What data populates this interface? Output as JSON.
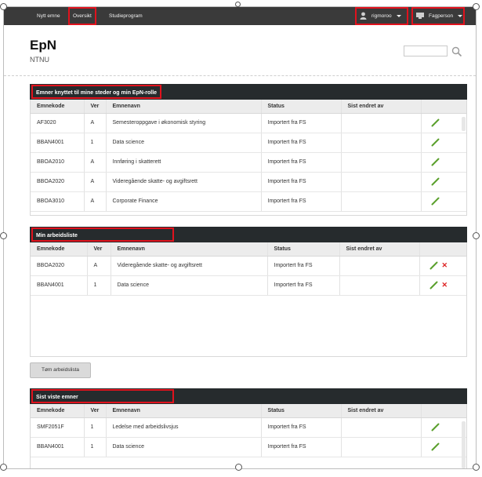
{
  "nav": {
    "links": [
      "Nytt emne",
      "Oversikt",
      "Studieprogram"
    ],
    "user": "rigmoroo",
    "role": "Fagperson"
  },
  "brand": {
    "title": "EpN",
    "subtitle": "NTNU"
  },
  "search": {
    "placeholder": ""
  },
  "sections": [
    {
      "title": "Emner knyttet til mine steder og min EpN-rolle",
      "columns": [
        "Emnekode",
        "Ver",
        "Emnenavn",
        "Status",
        "Sist endret av",
        ""
      ],
      "rows": [
        [
          "AF3020",
          "A",
          "Semesteroppgave i økonomisk styring",
          "Importert fra FS",
          ""
        ],
        [
          "BBAN4001",
          "1",
          "Data science",
          "Importert fra FS",
          ""
        ],
        [
          "BBOA2010",
          "A",
          "Innføring i skatterett",
          "Importert fra FS",
          ""
        ],
        [
          "BBOA2020",
          "A",
          "Videregående skatte- og avgiftsrett",
          "Importert fra FS",
          ""
        ],
        [
          "BBOA3010",
          "A",
          "Corporate Finance",
          "Importert fra FS",
          ""
        ]
      ]
    },
    {
      "title": "Min arbeidsliste",
      "columns": [
        "Emnekode",
        "Ver",
        "Emnenavn",
        "Status",
        "Sist endret av",
        ""
      ],
      "rows": [
        [
          "BBOA2020",
          "A",
          "Videregående skatte- og avgiftsrett",
          "Importert fra FS",
          ""
        ],
        [
          "BBAN4001",
          "1",
          "Data science",
          "Importert fra FS",
          ""
        ]
      ],
      "button": "Tøm arbeidslista"
    },
    {
      "title": "Sist viste emner",
      "columns": [
        "Emnekode",
        "Ver",
        "Emnenavn",
        "Status",
        "Sist endret av",
        ""
      ],
      "rows": [
        [
          "SMF2051F",
          "1",
          "Ledelse med arbeidslivsjus",
          "Importert fra FS",
          ""
        ],
        [
          "BBAN4001",
          "1",
          "Data science",
          "Importert fra FS",
          ""
        ]
      ]
    }
  ],
  "colors": {
    "navbar": "#3a3a3a",
    "section_header": "#262b2d",
    "highlight": "#e1121d",
    "edit_icon": "#5aa02c",
    "delete_icon": "#dd2222"
  }
}
